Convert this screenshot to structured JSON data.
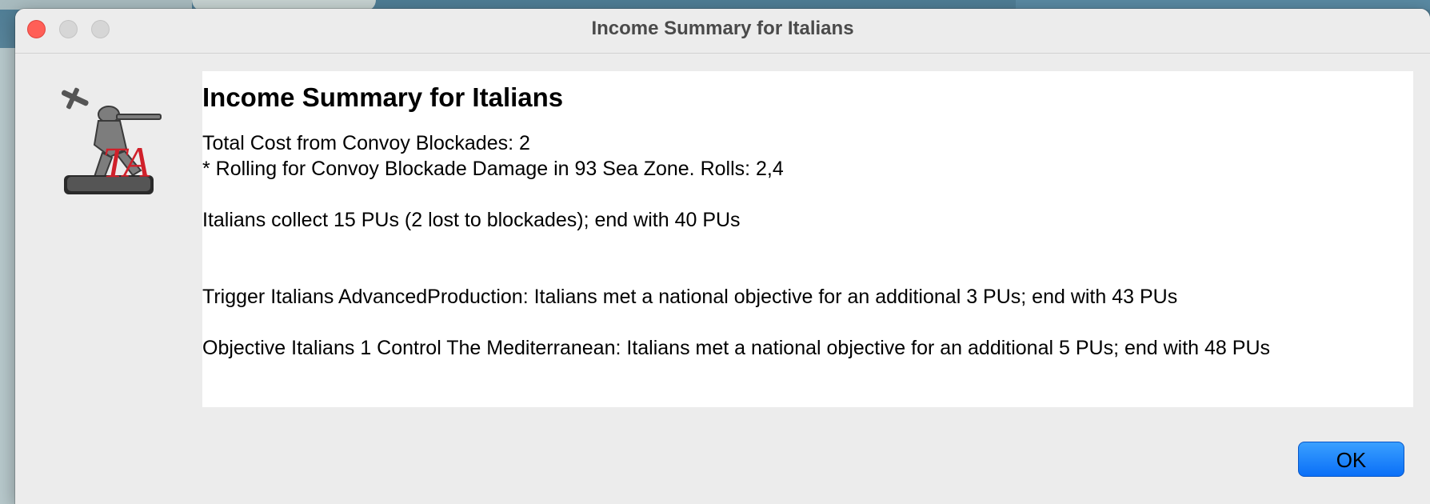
{
  "window": {
    "title": "Income Summary for Italians"
  },
  "message": {
    "heading": "Income Summary for Italians",
    "lines": [
      "Total Cost from Convoy Blockades: 2",
      "* Rolling for Convoy Blockade Damage in 93 Sea Zone. Rolls: 2,4",
      "Italians collect 15 PUs (2 lost to blockades); end with 40 PUs",
      "Trigger Italians AdvancedProduction: Italians met a national objective for an additional 3 PUs; end with 43 PUs",
      "Objective Italians 1 Control The Mediterranean: Italians met a national objective for an additional 5 PUs; end with 48 PUs"
    ]
  },
  "buttons": {
    "ok_label": "OK"
  },
  "icons": {
    "app_icon": "triplea-soldier-icon",
    "close": "close-icon",
    "minimize": "minimize-icon",
    "maximize": "maximize-icon"
  },
  "colors": {
    "close_button": "#ff5f57",
    "ok_button": "#0a6ff7",
    "logo_red": "#d0202a"
  }
}
